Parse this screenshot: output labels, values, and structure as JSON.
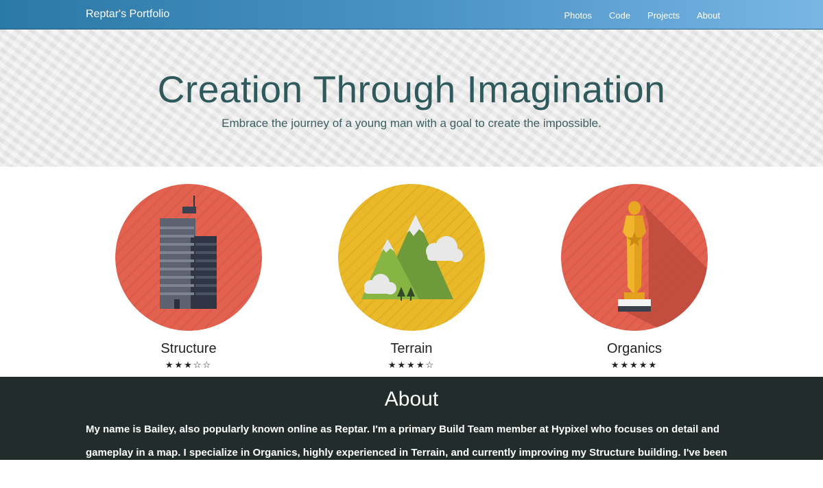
{
  "navbar": {
    "brand": "Reptar's Portfolio",
    "links": [
      "Photos",
      "Code",
      "Projects",
      "About"
    ]
  },
  "hero": {
    "title": "Creation Through Imagination",
    "subtitle": "Embrace the journey of a young man with a goal to create the impossible."
  },
  "skills": [
    {
      "name": "Structure",
      "stars": "★★★☆☆",
      "rating": 3,
      "icon": "skyscraper-icon",
      "circle_color": "#e2614f"
    },
    {
      "name": "Terrain",
      "stars": "★★★★☆",
      "rating": 4,
      "icon": "mountain-icon",
      "circle_color": "#e9b92a"
    },
    {
      "name": "Organics",
      "stars": "★★★★★",
      "rating": 5,
      "icon": "trophy-statue-icon",
      "circle_color": "#e2614f"
    }
  ],
  "about": {
    "title": "About",
    "p1": "My name is Bailey, also popularly known online as Reptar. I'm a primary Build Team member at Hypixel who focuses on detail and gameplay in a map. I specialize in ",
    "b1": "Organics",
    "p2": ", highly experienced in ",
    "b2": "Terrain",
    "p3": ", and currently improving my ",
    "b3": "Structure",
    "p4": " building. I've been on"
  },
  "colors": {
    "navbar_start": "#2a79a6",
    "navbar_end": "#79b6e4",
    "hero_text": "#2f5a5c",
    "about_bg": "#212c2b"
  }
}
